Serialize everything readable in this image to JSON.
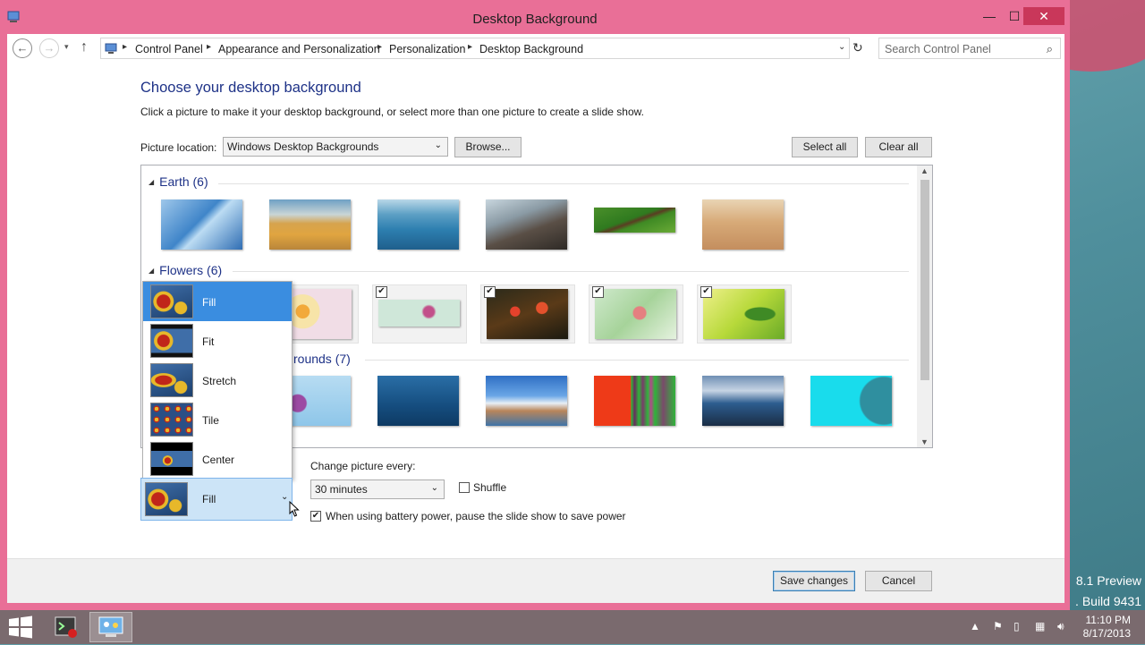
{
  "window": {
    "title": "Desktop Background"
  },
  "titlebar_buttons": {
    "minimize": "—",
    "maximize": "☐",
    "close": "✕"
  },
  "navigation": {
    "breadcrumbs": [
      "Control Panel",
      "Appearance and Personalization",
      "Personalization",
      "Desktop Background"
    ],
    "search_placeholder": "Search Control Panel"
  },
  "content": {
    "heading": "Choose your desktop background",
    "subtext": "Click a picture to make it your desktop background, or select more than one picture to create a slide show.",
    "picture_location_label": "Picture location:",
    "picture_location_value": "Windows Desktop Backgrounds",
    "browse_label": "Browse...",
    "select_all_label": "Select all",
    "clear_all_label": "Clear all"
  },
  "gallery": {
    "groups": [
      {
        "label": "Earth (6)"
      },
      {
        "label": "Flowers (6)"
      },
      {
        "label": "rounds (7)"
      }
    ]
  },
  "picture_position": {
    "selected": "Fill",
    "options": [
      "Fill",
      "Fit",
      "Stretch",
      "Tile",
      "Center"
    ]
  },
  "slideshow": {
    "change_label": "Change picture every:",
    "interval_value": "30 minutes",
    "shuffle_label": "Shuffle",
    "shuffle_checked": false,
    "battery_label": "When using battery power, pause the slide show to save power",
    "battery_checked": true
  },
  "footer": {
    "save_label": "Save changes",
    "cancel_label": "Cancel"
  },
  "watermark": {
    "line1": "8.1 Preview",
    "line2": ". Build 9431"
  },
  "taskbar": {
    "time": "11:10 PM",
    "date": "8/17/2013"
  },
  "colors": {
    "window_frame": "#e96f97",
    "heading": "#1e3287",
    "selection": "#3a8de0"
  }
}
